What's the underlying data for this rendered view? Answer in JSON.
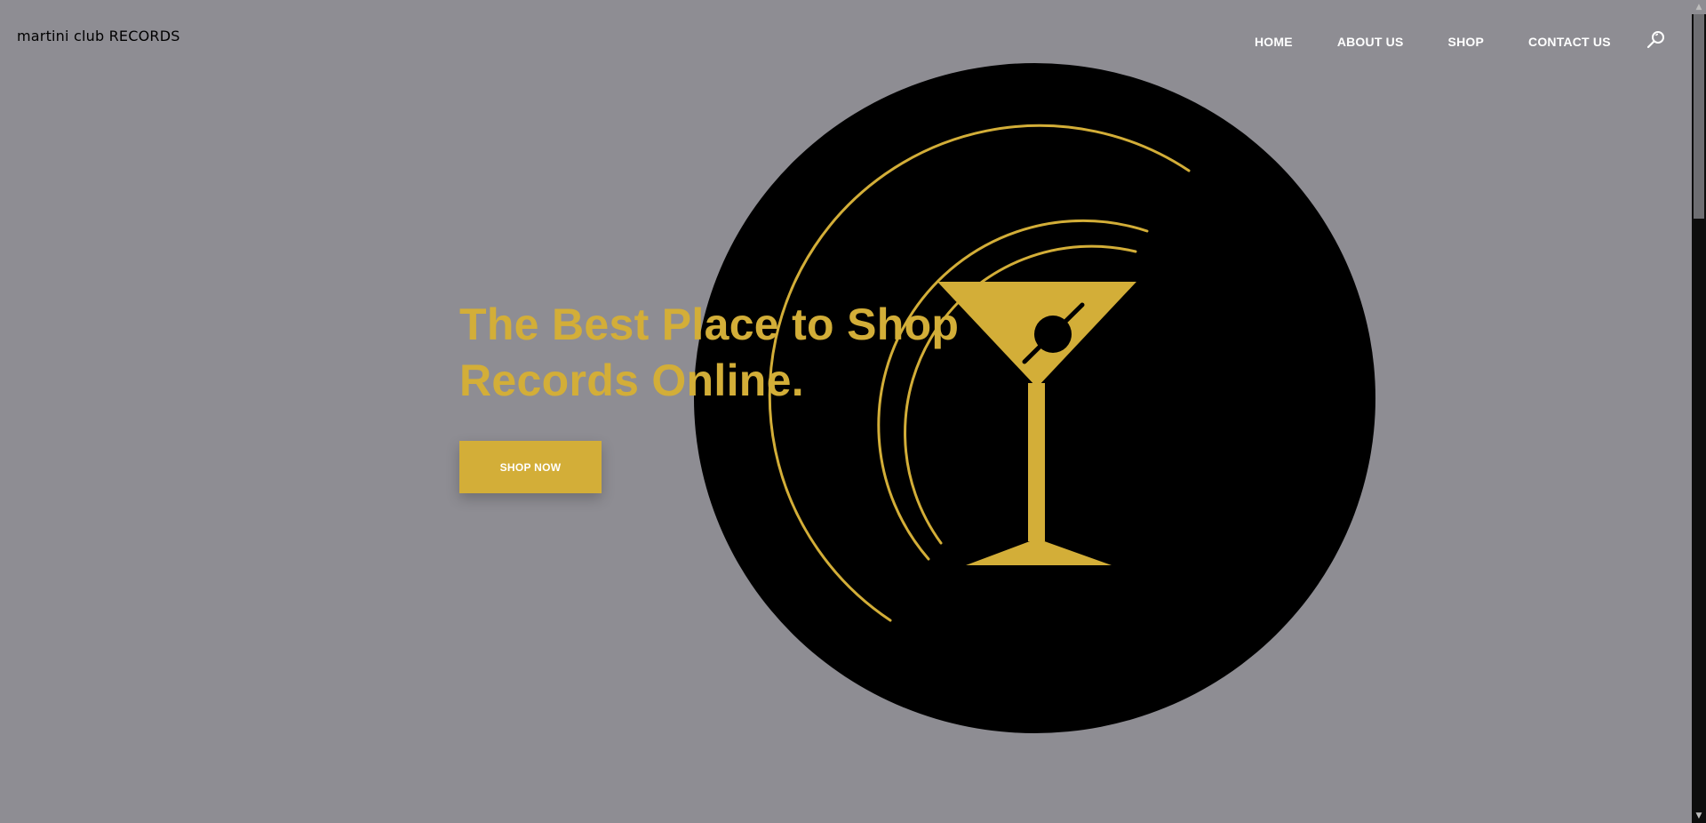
{
  "header": {
    "logo_text_lower": "martini club",
    "logo_text_upper": "RECORDS",
    "nav": [
      {
        "label": "HOME"
      },
      {
        "label": "ABOUT US"
      },
      {
        "label": "SHOP"
      },
      {
        "label": "CONTACT US"
      }
    ],
    "search_icon": "search-icon"
  },
  "hero": {
    "title_line1": "The Best Place to Shop",
    "title_line2": "Records Online.",
    "cta_label": "SHOP NOW"
  },
  "colors": {
    "background": "#8e8d93",
    "accent_gold": "#d3ae38",
    "disc": "#000000",
    "nav_text": "#ffffff"
  },
  "artwork": {
    "icon": "martini-glass-icon",
    "disc": "vinyl-record-icon"
  }
}
